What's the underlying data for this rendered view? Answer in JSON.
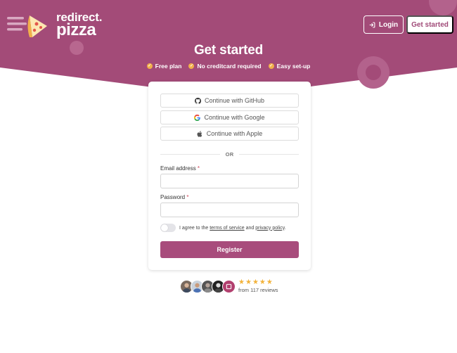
{
  "brand": {
    "line1": "redirect.",
    "line2": "pizza"
  },
  "nav": {
    "login_label": "Login",
    "get_started_label": "Get started"
  },
  "hero": {
    "title": "Get started",
    "features": [
      {
        "label": "Free plan",
        "icon": "check-circle-icon"
      },
      {
        "label": "No creditcard required",
        "icon": "check-circle-icon"
      },
      {
        "label": "Easy set-up",
        "icon": "check-circle-icon"
      }
    ]
  },
  "auth": {
    "github_label": "Continue with GitHub",
    "google_label": "Continue with Google",
    "apple_label": "Continue with Apple",
    "divider": "OR",
    "email_label": "Email address",
    "password_label": "Password",
    "required_mark": "*",
    "email_value": "",
    "password_value": "",
    "agree_prefix": "I agree to the",
    "terms_link": "terms of service",
    "agree_and": "and",
    "privacy_link": "privacy policy",
    "agree_suffix": ".",
    "terms_accepted": false,
    "register_label": "Register"
  },
  "reviews": {
    "stars": [
      "★",
      "★",
      "★",
      "★",
      "★"
    ],
    "count_text": "from 117 reviews"
  },
  "colors": {
    "brand": "#a84c7c",
    "hero_bg": "#a04a78",
    "star": "#f2b23a",
    "check": "#f2b04a"
  }
}
